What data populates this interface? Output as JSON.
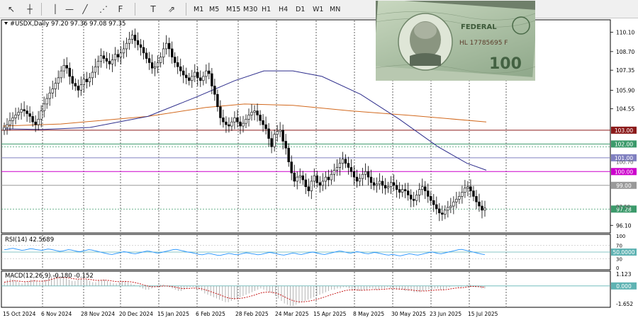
{
  "toolbar": {
    "tools": [
      {
        "name": "cursor-tool",
        "icon": "cursor-icon",
        "glyph": "↖"
      },
      {
        "name": "crosshair-tool",
        "icon": "crosshair-icon",
        "glyph": "┼"
      },
      {
        "name": "vertical-line-tool",
        "icon": "vertical-line-icon",
        "glyph": "│"
      },
      {
        "name": "horizontal-line-tool",
        "icon": "horizontal-line-icon",
        "glyph": "—"
      },
      {
        "name": "trendline-tool",
        "icon": "trendline-icon",
        "glyph": "╱"
      },
      {
        "name": "equidistant-channel-tool",
        "icon": "channel-icon",
        "glyph": "⋰"
      },
      {
        "name": "fibonacci-tool",
        "icon": "fibonacci-icon",
        "glyph": "F"
      },
      {
        "name": "text-tool",
        "icon": "text-icon",
        "glyph": "T"
      },
      {
        "name": "arrows-tool",
        "icon": "arrows-icon",
        "glyph": "⇗"
      }
    ],
    "timeframes": [
      "M1",
      "M5",
      "M15",
      "M30",
      "H1",
      "H4",
      "D1",
      "W1",
      "MN"
    ],
    "active_timeframe": "D1"
  },
  "chart_data": {
    "type": "candlestick",
    "symbol_info": "#USDX,Daily  97.20 97.36 97.08 97.35",
    "price_axis": {
      "range": [
        95.6,
        110.9
      ],
      "ticks": [
        "110.10",
        "108.70",
        "107.35",
        "105.90",
        "104.55",
        "96.10"
      ]
    },
    "x_labels": [
      "15 Oct 2024",
      "6 Nov 2024",
      "28 Nov 2024",
      "20 Dec 2024",
      "15 Jan 2025",
      "6 Feb 2025",
      "28 Feb 2025",
      "24 Mar 2025",
      "15 Apr 2025",
      "8 May 2025",
      "30 May 2025",
      "23 Jun 2025",
      "15 Jul 2025"
    ],
    "closes": [
      103.2,
      103.4,
      103.7,
      103.9,
      104.1,
      104.3,
      104.5,
      104.4,
      104.2,
      104.0,
      103.6,
      103.4,
      103.8,
      104.4,
      104.9,
      105.3,
      105.7,
      106.0,
      106.4,
      106.8,
      107.3,
      107.7,
      107.5,
      106.9,
      106.4,
      106.2,
      105.9,
      106.3,
      106.7,
      106.5,
      106.8,
      107.2,
      107.6,
      108.0,
      108.4,
      108.2,
      108.0,
      107.8,
      108.1,
      108.5,
      108.3,
      108.6,
      108.9,
      109.3,
      109.6,
      109.9,
      109.5,
      109.2,
      109.0,
      108.6,
      108.2,
      107.9,
      107.5,
      107.6,
      107.9,
      108.3,
      108.9,
      109.3,
      108.9,
      108.3,
      107.9,
      107.6,
      107.3,
      107.0,
      106.8,
      106.6,
      106.9,
      107.2,
      106.8,
      106.6,
      106.9,
      107.3,
      107.1,
      106.2,
      105.6,
      104.7,
      103.9,
      103.6,
      103.4,
      103.3,
      103.6,
      103.9,
      103.6,
      103.3,
      103.5,
      103.8,
      104.1,
      104.3,
      104.4,
      104.1,
      103.7,
      103.4,
      103.1,
      102.4,
      101.8,
      102.7,
      102.9,
      103.0,
      102.2,
      101.7,
      100.7,
      99.9,
      99.3,
      99.6,
      99.7,
      99.4,
      98.9,
      98.6,
      99.3,
      99.7,
      99.2,
      99.0,
      99.3,
      99.6,
      99.4,
      99.8,
      100.1,
      100.3,
      100.6,
      100.9,
      100.6,
      100.3,
      100.0,
      99.6,
      99.3,
      99.5,
      99.8,
      100.0,
      99.6,
      99.2,
      99.0,
      99.1,
      99.3,
      99.0,
      98.8,
      98.9,
      99.2,
      99.0,
      98.7,
      98.5,
      98.7,
      98.6,
      98.3,
      98.0,
      97.9,
      98.3,
      98.7,
      98.9,
      98.6,
      98.2,
      97.9,
      97.6,
      97.3,
      97.0,
      96.9,
      97.2,
      97.4,
      97.5,
      97.8,
      98.0,
      98.2,
      98.5,
      98.8,
      98.9,
      98.6,
      98.2,
      97.8,
      97.5,
      97.2,
      97.35
    ],
    "moving_averages": [
      {
        "name": "MA-long",
        "color": "#d2691e",
        "points": [
          [
            0,
            103.3
          ],
          [
            0.12,
            103.45
          ],
          [
            0.3,
            104.0
          ],
          [
            0.42,
            104.65
          ],
          [
            0.5,
            104.9
          ],
          [
            0.6,
            104.8
          ],
          [
            0.72,
            104.4
          ],
          [
            0.85,
            104.05
          ],
          [
            1.0,
            103.6
          ]
        ]
      },
      {
        "name": "MA-mid",
        "color": "#2e2e8c",
        "points": [
          [
            0,
            103.1
          ],
          [
            0.08,
            103.05
          ],
          [
            0.18,
            103.2
          ],
          [
            0.3,
            104.0
          ],
          [
            0.4,
            105.4
          ],
          [
            0.48,
            106.6
          ],
          [
            0.54,
            107.3
          ],
          [
            0.6,
            107.3
          ],
          [
            0.66,
            106.9
          ],
          [
            0.74,
            105.6
          ],
          [
            0.82,
            103.8
          ],
          [
            0.9,
            101.8
          ],
          [
            0.96,
            100.6
          ],
          [
            1.0,
            100.1
          ]
        ]
      }
    ],
    "horizontal_levels": [
      {
        "price": 103.0,
        "label": "103.00",
        "color": "#8b1a1a",
        "style": "solid"
      },
      {
        "price": 102.0,
        "label": "102.00",
        "color": "#3c9a6b",
        "style": "solid"
      },
      {
        "price": 101.8,
        "label": "",
        "color": "#3c9a6b",
        "style": "dotted"
      },
      {
        "price": 101.0,
        "label": "101.00",
        "color": "#8080c0",
        "style": "solid"
      },
      {
        "price": 100.0,
        "label": "100.00",
        "color": "#cc00cc",
        "style": "solid"
      },
      {
        "price": 99.0,
        "label": "99.00",
        "color": "#999999",
        "style": "solid"
      },
      {
        "price": 97.28,
        "label": "97.28",
        "color": "#3c9a6b",
        "style": "dotted"
      }
    ],
    "extra_axis_labels": [
      "100.70",
      "97.50"
    ],
    "rsi": {
      "label": "RSI(14) 42.5689",
      "ticks": [
        "100",
        "70",
        "30",
        "0"
      ],
      "level_label": "50.0000",
      "color": "#1e90ff",
      "values": [
        57,
        58,
        60,
        61,
        59,
        57,
        55,
        56,
        58,
        60,
        59,
        57,
        56,
        55,
        57,
        59,
        58,
        56,
        54,
        52,
        53,
        55,
        57,
        56,
        54,
        52,
        51,
        53,
        55,
        57,
        56,
        54,
        52,
        50,
        48,
        46,
        44,
        43,
        45,
        47,
        49,
        51,
        50,
        48,
        46,
        45,
        47,
        49,
        51,
        53,
        52,
        50,
        48,
        47,
        49,
        51,
        53,
        55,
        57,
        58,
        56,
        54,
        52,
        50,
        49,
        47,
        45,
        43,
        42,
        44,
        46,
        45,
        43,
        41,
        40,
        42,
        44,
        46,
        45,
        43,
        42,
        44,
        46,
        48,
        47,
        45,
        44,
        42,
        43,
        45,
        47,
        49,
        48,
        46,
        44,
        42,
        41,
        43,
        45,
        47,
        46,
        44,
        43,
        45,
        47,
        49,
        50,
        48,
        46,
        44,
        43,
        45,
        47,
        49,
        51,
        53,
        52,
        50,
        48,
        47,
        49,
        51,
        50,
        48,
        46,
        45,
        47,
        49,
        48,
        46,
        44,
        42,
        41,
        43,
        42,
        40,
        39,
        41,
        43,
        45,
        44,
        42,
        41,
        43,
        45,
        47,
        49,
        50,
        48,
        46,
        45,
        47,
        49,
        51,
        53,
        55,
        57,
        58,
        56,
        54,
        52,
        50,
        48,
        46,
        44,
        42.57
      ]
    },
    "macd": {
      "label": "MACD(12,26,9) -0.180 -0.152",
      "ticks": [
        "1.123",
        "0.000",
        "-1.652"
      ],
      "histogram": [
        0.3,
        0.5,
        0.6,
        0.5,
        0.4,
        0.3,
        0.2,
        0.3,
        0.4,
        0.5,
        0.5,
        0.4,
        0.3,
        0.4,
        0.5,
        0.7,
        0.8,
        0.9,
        0.9,
        0.8,
        0.7,
        0.6,
        0.5,
        0.4,
        0.4,
        0.5,
        0.6,
        0.6,
        0.5,
        0.4,
        0.3,
        0.3,
        0.4,
        0.5,
        0.5,
        0.4,
        0.3,
        0.2,
        0.2,
        0.3,
        0.4,
        0.4,
        0.3,
        0.2,
        0.1,
        0.0,
        -0.1,
        -0.2,
        -0.3,
        -0.3,
        -0.2,
        -0.1,
        0.0,
        0.1,
        0.1,
        0.0,
        -0.1,
        -0.2,
        -0.3,
        -0.4,
        -0.4,
        -0.3,
        -0.2,
        -0.1,
        -0.1,
        -0.2,
        -0.3,
        -0.4,
        -0.6,
        -0.7,
        -0.8,
        -0.9,
        -1.0,
        -1.1,
        -1.2,
        -1.3,
        -1.3,
        -1.2,
        -1.1,
        -1.0,
        -0.9,
        -0.8,
        -0.7,
        -0.6,
        -0.5,
        -0.4,
        -0.3,
        -0.2,
        -0.3,
        -0.4,
        -0.5,
        -0.6,
        -0.8,
        -1.0,
        -1.2,
        -1.4,
        -1.5,
        -1.6,
        -1.6,
        -1.5,
        -1.4,
        -1.3,
        -1.2,
        -1.1,
        -1.0,
        -0.9,
        -0.8,
        -0.7,
        -0.6,
        -0.5,
        -0.4,
        -0.3,
        -0.3,
        -0.2,
        -0.2,
        -0.1,
        -0.1,
        -0.2,
        -0.3,
        -0.3,
        -0.4,
        -0.4,
        -0.3,
        -0.3,
        -0.2,
        -0.2,
        -0.3,
        -0.3,
        -0.2,
        -0.2,
        -0.1,
        -0.2,
        -0.2,
        -0.3,
        -0.3,
        -0.3,
        -0.4,
        -0.4,
        -0.4,
        -0.5,
        -0.5,
        -0.5,
        -0.4,
        -0.4,
        -0.3,
        -0.3,
        -0.2,
        -0.2,
        -0.3,
        -0.3,
        -0.2,
        -0.1,
        0.0,
        0.0,
        -0.1,
        -0.1,
        0.0,
        0.1,
        0.1,
        0.0,
        -0.1,
        -0.1,
        -0.2,
        -0.2
      ],
      "signal_color": "#c00000",
      "zero_line_color": "#5fb3b3"
    }
  }
}
